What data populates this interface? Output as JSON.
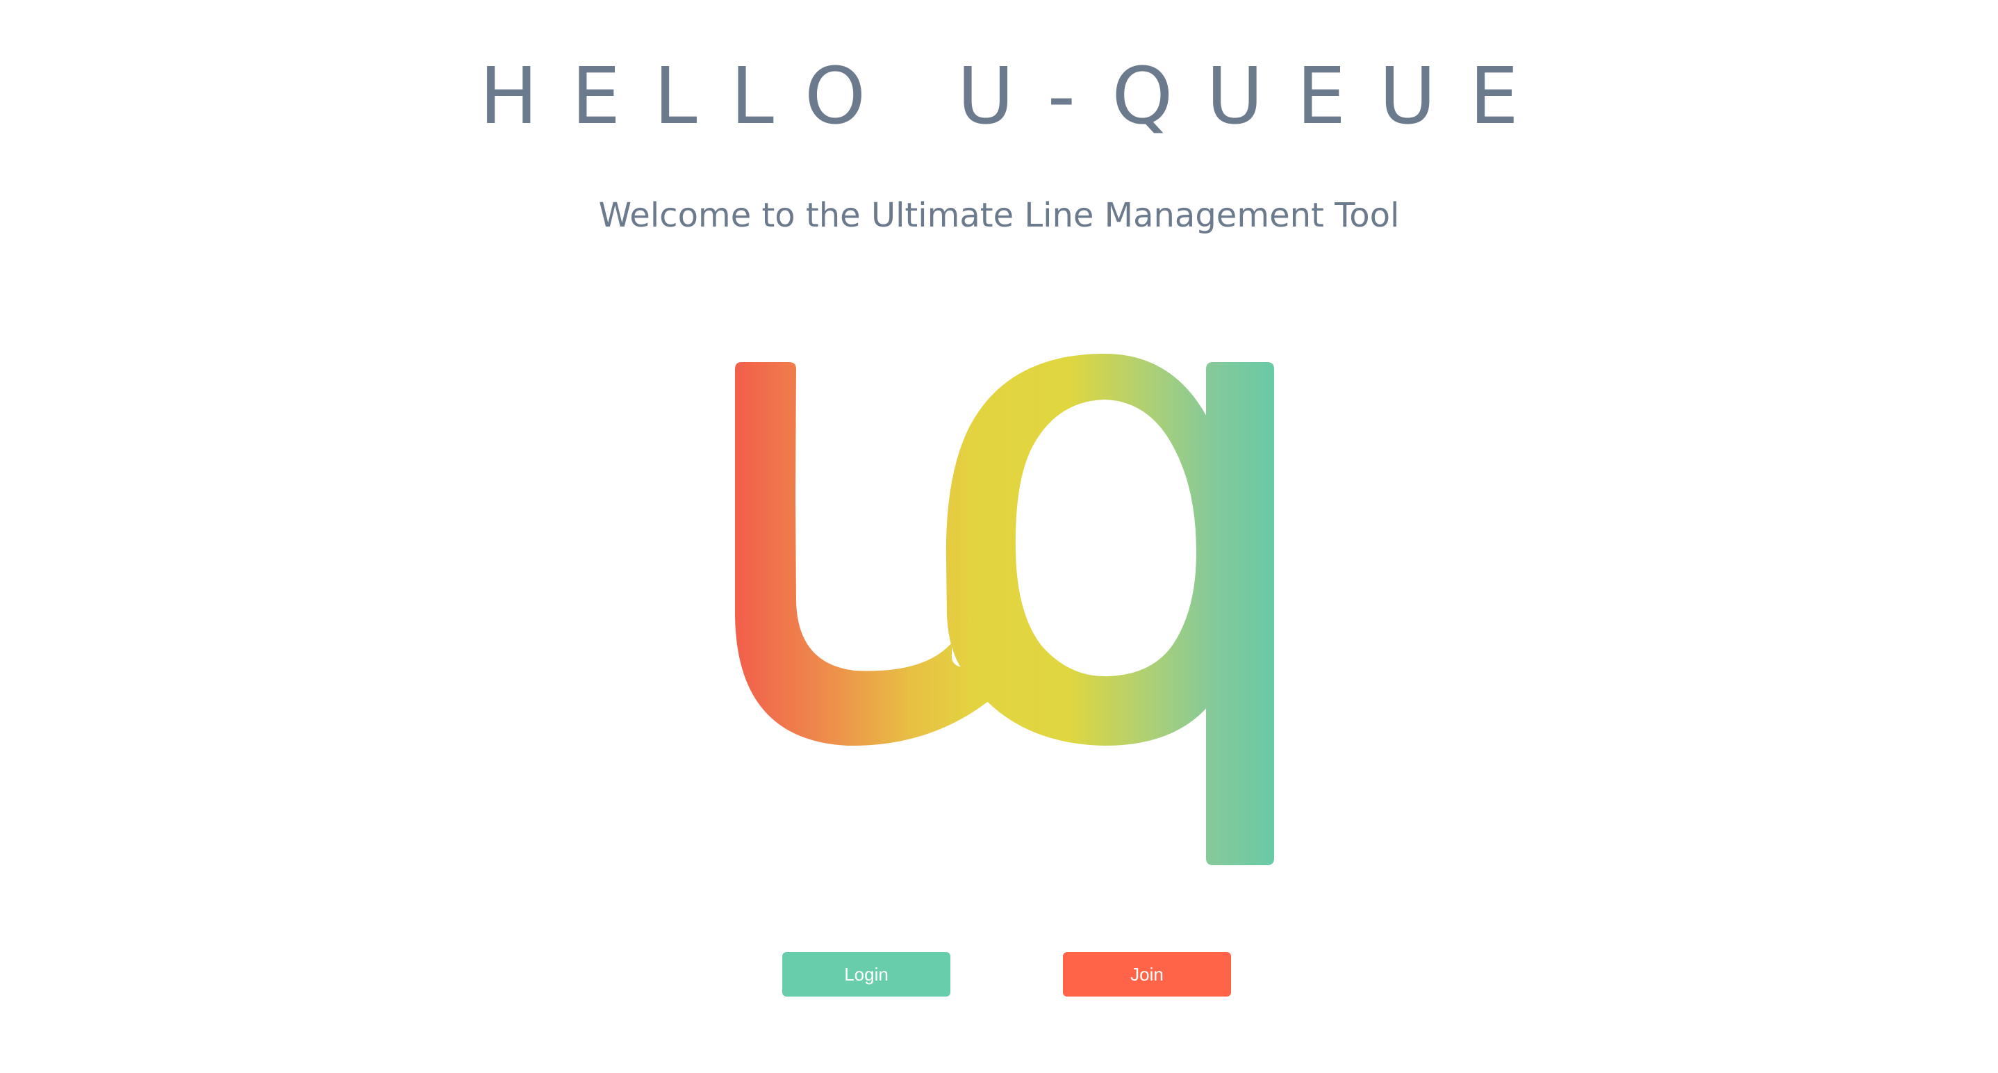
{
  "header": {
    "title": "HELLO U-QUEUE",
    "subtitle": "Welcome to the Ultimate Line Management Tool"
  },
  "logo": {
    "icon": "uq-logo-icon",
    "gradient_colors": [
      "#f25c4b",
      "#e8a74a",
      "#e3d43f",
      "#dfd640",
      "#88c996",
      "#67c9a7"
    ]
  },
  "actions": {
    "login_label": "Login",
    "join_label": "Join",
    "login_color": "#67cdab",
    "join_color": "#ff6449"
  }
}
